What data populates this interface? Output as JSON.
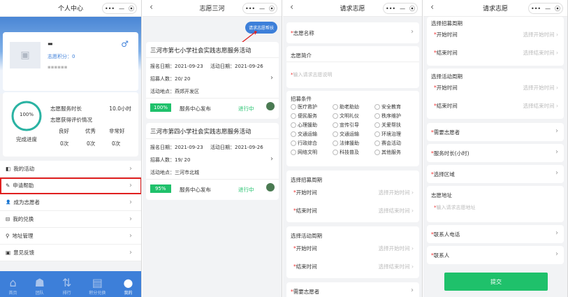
{
  "p1": {
    "title": "个人中心",
    "capsule": [
      "•••",
      "—",
      "⦿"
    ],
    "user_name": "▬",
    "score": "志愿积分：0",
    "sub": "▪▪▪▪▪▪",
    "gender": "♂",
    "progress_text": "100%",
    "progress_label": "完成进度",
    "progress": 1.0,
    "hours_label": "志愿服务时长",
    "hours_value": "10.0小时",
    "eval_label": "志愿获得评价情况",
    "eval_heads": [
      "良好",
      "优秀",
      "非常好"
    ],
    "eval_vals": [
      "0次",
      "0次",
      "0次"
    ],
    "menu": [
      {
        "icon": "◧",
        "label": "我的活动"
      },
      {
        "icon": "✎",
        "label": "申请帮助"
      },
      {
        "icon": "👤",
        "label": "成为志愿者"
      },
      {
        "icon": "⊟",
        "label": "我的兑换"
      },
      {
        "icon": "⚲",
        "label": "地址管理"
      },
      {
        "icon": "▣",
        "label": "意见反馈"
      }
    ],
    "tabs": [
      "首页",
      "团队",
      "排行",
      "积分兑换",
      "我的"
    ]
  },
  "p2": {
    "title": "志愿三河",
    "help_btn": "请求志愿帮扶",
    "cards": [
      {
        "title": "三河市第七小学社会实践志愿服务活动",
        "signup": "报名日期：2021-09-23",
        "activity": "活动日期：2021-09-26",
        "recruit": "招募人数：20/ 20",
        "place": "活动地点：燕郊开发区",
        "pct": "100%",
        "org": "服务中心发布",
        "status": "进行中"
      },
      {
        "title": "三河市第四小学社会实践志愿服务活动",
        "signup": "报名日期：2021-09-23",
        "activity": "活动日期：2021-09-26",
        "recruit": "招募人数：19/ 20",
        "place": "活动地点：三河市北城",
        "pct": "95%",
        "org": "服务中心发布",
        "status": "进行中"
      }
    ]
  },
  "p3": {
    "title": "请求志愿",
    "name_label": "志愿名称",
    "intro_label": "志愿简介",
    "intro_ph": "输入请求志愿说明",
    "cond_label": "招募条件",
    "conditions": [
      "医疗救护",
      "助老助幼",
      "安全教育",
      "便民服务",
      "文明礼仪",
      "秩序维护",
      "心理援助",
      "宣传引导",
      "关爱帮扶",
      "交通运输",
      "交通运输",
      "环境治理",
      "行政综合",
      "法律援助",
      "赛会活动",
      "网络文明",
      "科技普及",
      "其他服务"
    ],
    "recruit_period": "选择招募周期",
    "activity_period": "选择活动周期",
    "start": "开始时间",
    "end": "结束时间",
    "start_ph": "选择开始时间",
    "end_ph": "选择结束时间",
    "need": "需要志愿者"
  },
  "p4": {
    "title": "请求志愿",
    "recruit_period": "选择招募周期",
    "activity_period": "选择活动周期",
    "start": "开始时间",
    "end": "结束时间",
    "start_ph": "选择开始时间",
    "end_ph": "选择结束时间",
    "need": "需要志愿者",
    "duration": "服务时长(小时)",
    "region": "选择区域",
    "addr_label": "志愿地址",
    "addr_ph": "输入请求志愿地址",
    "phone": "联系人电话",
    "contact": "联系人",
    "submit": "提交"
  },
  "colors": {
    "green": "#1fc16b",
    "red": "#e02020",
    "blue": "#3d7fd9"
  }
}
